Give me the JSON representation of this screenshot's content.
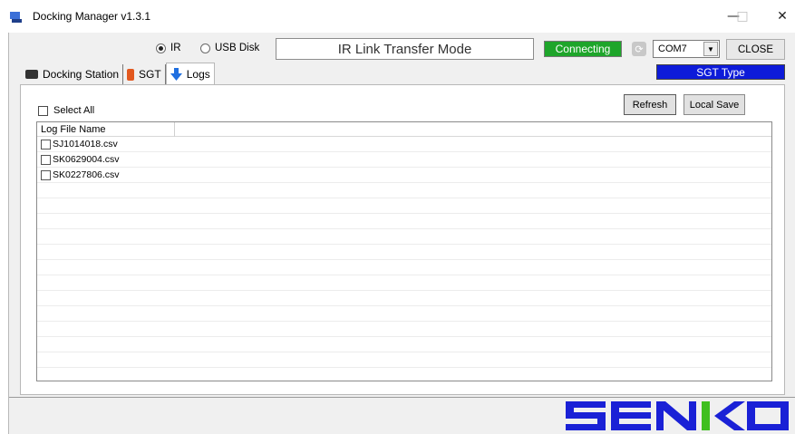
{
  "window": {
    "title": "Docking Manager v1.3.1",
    "minimize_glyph": "—",
    "maximize_glyph": "□",
    "close_glyph": "✕"
  },
  "connection": {
    "radio_ir_label": "IR",
    "radio_usb_label": "USB Disk",
    "selected": "IR",
    "mode_text": "IR Link Transfer Mode",
    "status_text": "Connecting",
    "status_color": "#1ea52a",
    "port_value": "COM7",
    "close_label": "CLOSE",
    "type_text": "SGT Type",
    "type_color": "#0d1bd9"
  },
  "tabs": [
    {
      "label": "Docking Station",
      "icon": "docking-station-icon"
    },
    {
      "label": "SGT",
      "icon": "sgt-device-icon"
    },
    {
      "label": "Logs",
      "icon": "download-arrow-icon",
      "active": true
    }
  ],
  "logs": {
    "select_all_label": "Select All",
    "refresh_label": "Refresh",
    "local_save_label": "Local Save",
    "column_header": "Log File Name",
    "files": [
      "SJ1014018.csv",
      "SK0629004.csv",
      "SK0227806.csv"
    ]
  },
  "brand": {
    "logo_text": "SENKO",
    "logo_color": "#1a21d6",
    "logo_accent": "#3fbf1f"
  }
}
